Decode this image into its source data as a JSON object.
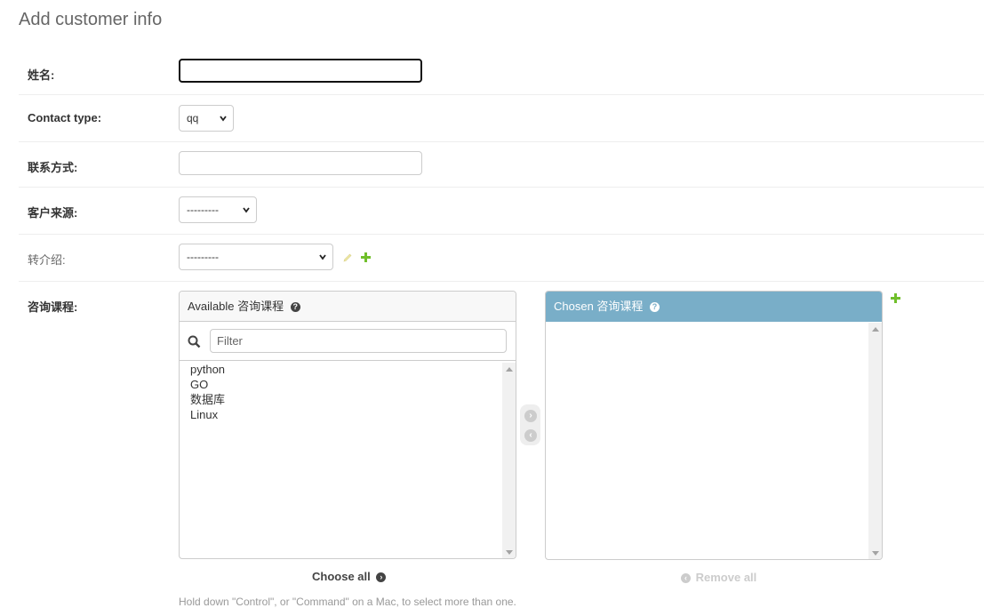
{
  "page": {
    "title": "Add customer info"
  },
  "fields": {
    "name": {
      "label": "姓名:",
      "value": ""
    },
    "contact_type": {
      "label": "Contact type:",
      "selected": "qq"
    },
    "contact": {
      "label": "联系方式:",
      "value": ""
    },
    "source": {
      "label": "客户来源:",
      "selected": "---------"
    },
    "referral": {
      "label": "转介绍:",
      "selected": "---------"
    },
    "courses": {
      "label": "咨询课程:",
      "available_title": "Available 咨询课程",
      "chosen_title": "Chosen 咨询课程",
      "filter_placeholder": "Filter",
      "available_options": [
        "python",
        "GO",
        "数据库",
        "Linux"
      ],
      "chosen_options": [],
      "choose_all": "Choose all",
      "remove_all": "Remove all",
      "help": "Hold down \"Control\", or \"Command\" on a Mac, to select more than one."
    }
  },
  "icons": {
    "search": "search-icon",
    "edit": "pencil-icon",
    "add": "plus-icon",
    "help": "question-icon",
    "arrow_right": "arrow-right-circle-icon",
    "arrow_left": "arrow-left-circle-icon"
  },
  "colors": {
    "accent": "#79aec8",
    "add_green": "#70bf2b",
    "edit_yellow": "#efe9a6"
  }
}
